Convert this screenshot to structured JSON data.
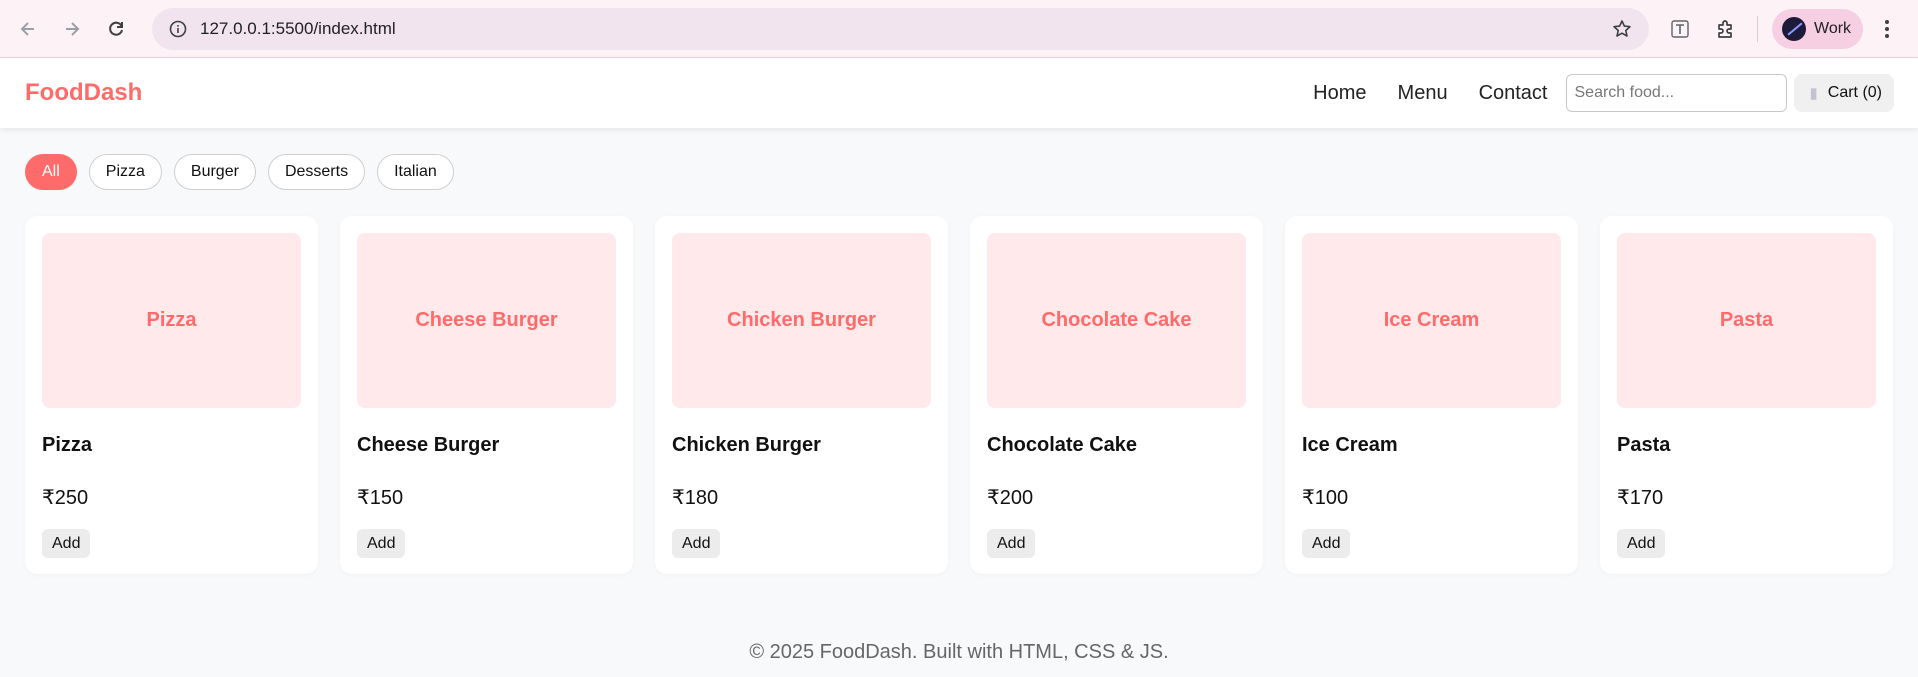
{
  "browser": {
    "url": "127.0.0.1:5500/index.html",
    "profile_label": "Work",
    "icons": {
      "back": "arrow-left-icon",
      "forward": "arrow-right-icon",
      "reload": "reload-icon",
      "site_info": "info-icon",
      "bookmark": "star-icon",
      "translate": "translate-icon",
      "extensions": "puzzle-icon",
      "menu": "kebab-menu-icon"
    }
  },
  "header": {
    "brand": "FoodDash",
    "nav": [
      "Home",
      "Menu",
      "Contact"
    ],
    "search_placeholder": "Search food...",
    "cart_label": "Cart (0)"
  },
  "filters": {
    "items": [
      "All",
      "Pizza",
      "Burger",
      "Desserts",
      "Italian"
    ],
    "selected": "All"
  },
  "products": [
    {
      "name": "Pizza",
      "image_label": "Pizza",
      "price": "₹250",
      "button": "Add"
    },
    {
      "name": "Cheese Burger",
      "image_label": "Cheese Burger",
      "price": "₹150",
      "button": "Add"
    },
    {
      "name": "Chicken Burger",
      "image_label": "Chicken Burger",
      "price": "₹180",
      "button": "Add"
    },
    {
      "name": "Chocolate Cake",
      "image_label": "Chocolate Cake",
      "price": "₹200",
      "button": "Add"
    },
    {
      "name": "Ice Cream",
      "image_label": "Ice Cream",
      "price": "₹100",
      "button": "Add"
    },
    {
      "name": "Pasta",
      "image_label": "Pasta",
      "price": "₹170",
      "button": "Add"
    }
  ],
  "footer": {
    "text": "© 2025 FoodDash. Built with HTML, CSS & JS."
  },
  "colors": {
    "accent": "#ff6b6b",
    "thumb_bg": "#ffe9ea",
    "page_bg": "#f8f9fb"
  }
}
